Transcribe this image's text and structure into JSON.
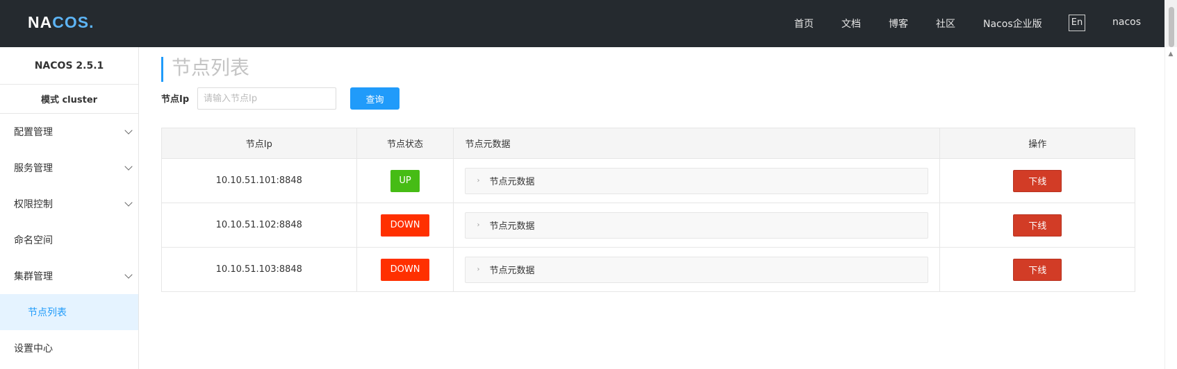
{
  "header": {
    "logo": {
      "left": "NA",
      "mid": "COS",
      "dot": "."
    },
    "nav": [
      "首页",
      "文档",
      "博客",
      "社区",
      "Nacos企业版"
    ],
    "lang": "En",
    "user": "nacos"
  },
  "sidebar": {
    "version": "NACOS 2.5.1",
    "mode": "模式 cluster",
    "items": [
      {
        "label": "配置管理",
        "expandable": true
      },
      {
        "label": "服务管理",
        "expandable": true
      },
      {
        "label": "权限控制",
        "expandable": true
      },
      {
        "label": "命名空间",
        "expandable": false
      },
      {
        "label": "集群管理",
        "expandable": true
      },
      {
        "label": "节点列表",
        "expandable": false,
        "active": true
      },
      {
        "label": "设置中心",
        "expandable": false
      }
    ]
  },
  "main": {
    "title": "节点列表",
    "filter": {
      "label": "节点Ip",
      "placeholder": "请输入节点Ip",
      "value": "",
      "button": "查询"
    },
    "table": {
      "headers": [
        "节点Ip",
        "节点状态",
        "节点元数据",
        "操作"
      ],
      "rows": [
        {
          "ip": "10.10.51.101:8848",
          "state": "UP",
          "meta": "节点元数据",
          "action": "下线"
        },
        {
          "ip": "10.10.51.102:8848",
          "state": "DOWN",
          "meta": "节点元数据",
          "action": "下线"
        },
        {
          "ip": "10.10.51.103:8848",
          "state": "DOWN",
          "meta": "节点元数据",
          "action": "下线"
        }
      ]
    }
  },
  "colors": {
    "header_bg": "#252a2f",
    "accent": "#209bfa",
    "status_up": "#46bc15",
    "status_down": "#ff3000",
    "offline_button": "#d23c26"
  }
}
